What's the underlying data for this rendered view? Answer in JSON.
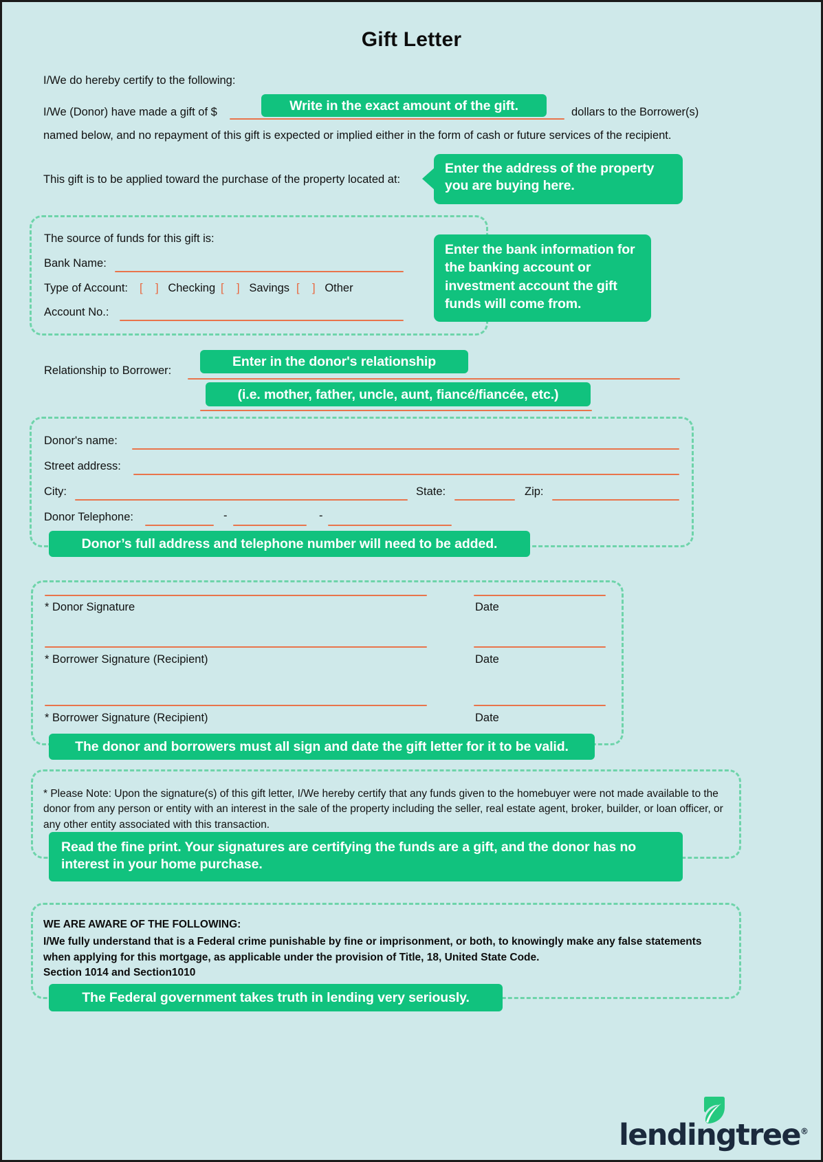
{
  "document": {
    "title": "Gift Letter",
    "intro": "I/We do hereby certify to the following:",
    "gift_line_pre": "I/We (Donor) have made a gift of $",
    "gift_line_post": "dollars to the Borrower(s)",
    "gift_line_2": "named below, and no repayment of this gift is expected or implied either in the form of cash or future services of the recipient.",
    "property_line": "This gift is to be applied toward the purchase of the property located at:"
  },
  "source_of_funds": {
    "heading": "The source of funds for this gift is:",
    "bank_name_label": "Bank Name:",
    "type_of_account_label": "Type of Account:",
    "checkbox_open": "[",
    "checkbox_close": "]",
    "options": [
      "Checking",
      "Savings",
      "Other"
    ],
    "account_no_label": "Account No.:"
  },
  "relationship": {
    "label": "Relationship to Borrower:"
  },
  "donor": {
    "name_label": "Donor's name:",
    "street_label": "Street address:",
    "city_label": "City:",
    "state_label": "State:",
    "zip_label": "Zip:",
    "telephone_label": "Donor Telephone:",
    "phone_sep": "-"
  },
  "signatures": {
    "rows": [
      {
        "signature_label": "* Donor Signature",
        "date_label": "Date"
      },
      {
        "signature_label": "* Borrower Signature (Recipient)",
        "date_label": "Date"
      },
      {
        "signature_label": "* Borrower Signature (Recipient)",
        "date_label": "Date"
      }
    ]
  },
  "please_note": {
    "text": "* Please Note:  Upon the signature(s) of this gift letter, I/We hereby certify that any funds given to the homebuyer were not made available to the donor from any person or entity with an interest in the sale of the property including the seller, real estate agent, broker, builder, or loan officer, or any other entity associated with this transaction."
  },
  "aware": {
    "heading": "WE ARE AWARE OF THE FOLLOWING:",
    "paragraph": "I/We fully understand that is a Federal crime punishable by fine or imprisonment, or both, to knowingly make any false statements when applying for this mortgage, as applicable under the provision of Title, 18, United State Code.",
    "sections": "Section 1014 and Section1010"
  },
  "callouts": {
    "gift_amount": "Write in the exact amount of the gift.",
    "property_address": "Enter the address of the property you are buying here.",
    "bank_info": "Enter the bank information for the banking account or investment account the gift funds will come from.",
    "relationship_1": "Enter in the donor's relationship",
    "relationship_2": "(i.e. mother, father, uncle, aunt, fiancé/fiancée, etc.)",
    "donor_address": "Donor’s full address and telephone number will need to be added.",
    "signatures": "The donor and borrowers must all sign and date the gift letter for it to be valid.",
    "fine_print": "Read the fine print. Your signatures are certifying the funds are a gift, and the donor has no interest in your home purchase.",
    "federal": "The Federal government takes truth in lending very seriously."
  },
  "brand": {
    "logo_text": "lendingtree",
    "registered_mark": "®"
  },
  "colors": {
    "background": "#cfe9ea",
    "callout_green": "#11c27e",
    "dashed_green": "#6ed4aa",
    "rule_orange": "#e9744b",
    "logo_navy": "#1b2a3d",
    "leaf_green": "#25c97f"
  }
}
